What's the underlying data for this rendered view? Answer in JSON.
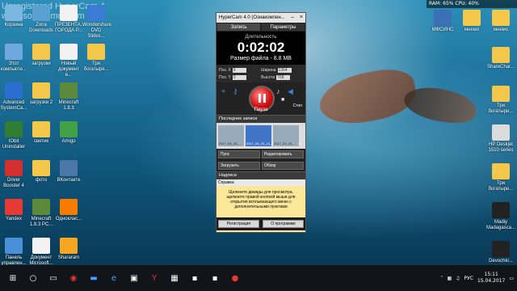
{
  "watermark": {
    "line1": "Unregistered HyperCam 4",
    "line2": "www.solveigmm.com"
  },
  "desktop_icons_left": [
    {
      "label": "Корзина",
      "icon": "recycle-bin-icon",
      "color": "#7ab8e0"
    },
    {
      "label": "Zona Downloads",
      "icon": "zona-icon",
      "color": "#5aa0d0"
    },
    {
      "label": "ПРЕЗЕНТА... ГОРОДА Р...",
      "icon": "document-icon",
      "color": "#f2f2f2"
    },
    {
      "label": "Wondershare DVD Slides...",
      "icon": "wondershare-icon",
      "color": "#3a7bd5"
    },
    {
      "label": "Этот компьюте...",
      "icon": "computer-icon",
      "color": "#6fa8dc"
    },
    {
      "label": "загрузки",
      "icon": "folder-icon",
      "color": "#f3c74a"
    },
    {
      "label": "Новый документ в...",
      "icon": "document-icon",
      "color": "#f2f2f2"
    },
    {
      "label": "Три богатыря...",
      "icon": "folder-icon",
      "color": "#f3c74a"
    },
    {
      "label": "Advanced SystemCa...",
      "icon": "advanced-systemcare-icon",
      "color": "#2a6fd0"
    },
    {
      "label": "загрузки 2",
      "icon": "folder-icon",
      "color": "#f3c74a"
    },
    {
      "label": "Minecraft 1.8.3",
      "icon": "minecraft-icon",
      "color": "#5c8a3a"
    },
    {
      "label": "IObit Uninstaller",
      "icon": "iobit-icon",
      "color": "#2e7d32"
    },
    {
      "label": "светик",
      "icon": "folder-icon",
      "color": "#f3c74a"
    },
    {
      "label": "Amigo",
      "icon": "amigo-icon",
      "color": "#43a047"
    },
    {
      "label": "Driver Booster 4",
      "icon": "driver-booster-icon",
      "color": "#d32f2f"
    },
    {
      "label": "фото",
      "icon": "folder-icon",
      "color": "#f3c74a"
    },
    {
      "label": "ВКонтакте",
      "icon": "vk-icon",
      "color": "#4a76a8"
    },
    {
      "label": "Yandex",
      "icon": "yandex-icon",
      "color": "#e53935"
    },
    {
      "label": "Minecraft 1.8.3 PC...",
      "icon": "minecraft-icon",
      "color": "#5c8a3a"
    },
    {
      "label": "Одноклас...",
      "icon": "odnoklassniki-icon",
      "color": "#f57c00"
    },
    {
      "label": "Панель управлен...",
      "icon": "control-panel-icon",
      "color": "#4a90d9"
    },
    {
      "label": "Документ Microsoft...",
      "icon": "word-doc-icon",
      "color": "#f2f2f2"
    },
    {
      "label": "Shararam",
      "icon": "shararam-icon",
      "color": "#f5a623"
    }
  ],
  "desktop_icons_right": [
    {
      "label": "МФСИНС",
      "icon": "app-icon",
      "color": "#3b6fb6"
    },
    {
      "label": "мнемо",
      "icon": "folder-icon",
      "color": "#f3c74a"
    },
    {
      "label": "мнемо",
      "icon": "folder-icon",
      "color": "#f3c74a"
    },
    {
      "label": "ShareChar...",
      "icon": "folder-icon",
      "color": "#f3c74a"
    },
    {
      "label": "Три богатыри...",
      "icon": "folder-icon",
      "color": "#f3c74a"
    },
    {
      "label": "HP Deskjet 1510 series",
      "icon": "printer-icon",
      "color": "#dcdcdc"
    },
    {
      "label": "Три богатыре...",
      "icon": "folder-icon",
      "color": "#f3c74a"
    },
    {
      "label": "Madiy Madagasca...",
      "icon": "app-icon",
      "color": "#222"
    },
    {
      "label": "Devochki...",
      "icon": "app-icon",
      "color": "#222"
    }
  ],
  "system_widget": {
    "text": "RAM: 65%  CPU: 40%"
  },
  "hypercam": {
    "title": "HyperCam 4.0 (Ознакомлен...",
    "minimize": "–",
    "close": "×",
    "tabs": [
      "Запись",
      "Параметры"
    ],
    "duration_label": "Длительность",
    "time": "0:02:02",
    "file_size": "Размер файла - 8.8 MB",
    "coords": {
      "pos_x_label": "Поз. X",
      "pos_x": "0",
      "width_label": "Ширина",
      "width": "1364",
      "pos_y_label": "Поз. Y",
      "pos_y": "0",
      "height_label": "Высота",
      "height": "768"
    },
    "pause_label": "Пауза",
    "stop_label": "Стоп",
    "recent_header": "Последние записи",
    "thumbs": [
      {
        "text": "2017_04_15_..."
      },
      {
        "text": "2017_04_15_14_37_41_549(8.6).mp4"
      },
      {
        "text": "2017_04_15_..."
      }
    ],
    "buttons": [
      "Пуск",
      "Редактировать",
      "Загрузить",
      "Обзор"
    ],
    "captions_header": "Надписи",
    "help_title": "Справка",
    "help_text": "Щелкните дважды для просмотра, щелкните правой кнопкой мыши для открытия всплывающего меню с дополнительными пунктами",
    "footer": [
      "Регистрация",
      "О программе"
    ]
  },
  "taskbar": {
    "icons": [
      "windows-icon",
      "search-icon",
      "task-view-icon",
      "record-icon",
      "explorer-icon",
      "edge-icon",
      "store-icon",
      "yandex-icon",
      "minecraft-icon",
      "app-icon",
      "app-icon",
      "hypercam-icon"
    ],
    "lang": "РУС",
    "time": "15:11",
    "date": "15.04.2017"
  }
}
